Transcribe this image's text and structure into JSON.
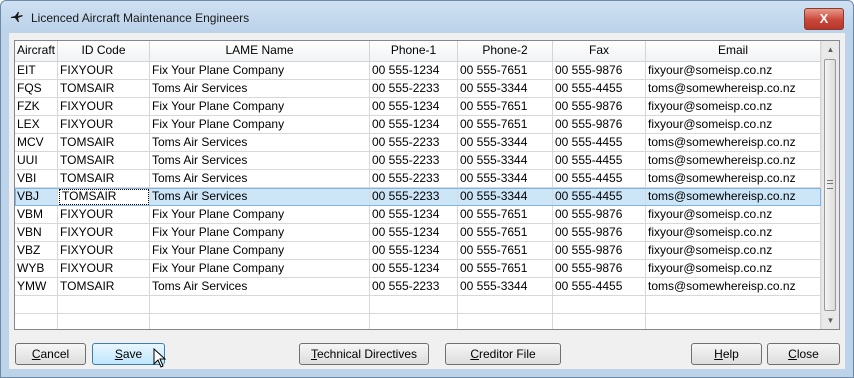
{
  "window": {
    "title": "Licenced Aircraft Maintenance Engineers",
    "close_symbol": "X"
  },
  "grid": {
    "columns": [
      "Aircraft",
      "ID Code",
      "LAME Name",
      "Phone-1",
      "Phone-2",
      "Fax",
      "Email"
    ],
    "selected_row": 7,
    "rows": [
      [
        "EIT",
        "FIXYOUR",
        "Fix Your Plane Company",
        "00 555-1234",
        "00 555-7651",
        "00 555-9876",
        "fixyour@someisp.co.nz"
      ],
      [
        "FQS",
        "TOMSAIR",
        "Toms Air Services",
        "00 555-2233",
        "00 555-3344",
        "00 555-4455",
        "toms@somewhereisp.co.nz"
      ],
      [
        "FZK",
        "FIXYOUR",
        "Fix Your Plane Company",
        "00 555-1234",
        "00 555-7651",
        "00 555-9876",
        "fixyour@someisp.co.nz"
      ],
      [
        "LEX",
        "FIXYOUR",
        "Fix Your Plane Company",
        "00 555-1234",
        "00 555-7651",
        "00 555-9876",
        "fixyour@someisp.co.nz"
      ],
      [
        "MCV",
        "TOMSAIR",
        "Toms Air Services",
        "00 555-2233",
        "00 555-3344",
        "00 555-4455",
        "toms@somewhereisp.co.nz"
      ],
      [
        "UUI",
        "TOMSAIR",
        "Toms Air Services",
        "00 555-2233",
        "00 555-3344",
        "00 555-4455",
        "toms@somewhereisp.co.nz"
      ],
      [
        "VBI",
        "TOMSAIR",
        "Toms Air Services",
        "00 555-2233",
        "00 555-3344",
        "00 555-4455",
        "toms@somewhereisp.co.nz"
      ],
      [
        "VBJ",
        "TOMSAIR",
        "Toms Air Services",
        "00 555-2233",
        "00 555-3344",
        "00 555-4455",
        "toms@somewhereisp.co.nz"
      ],
      [
        "VBM",
        "FIXYOUR",
        "Fix Your Plane Company",
        "00 555-1234",
        "00 555-7651",
        "00 555-9876",
        "fixyour@someisp.co.nz"
      ],
      [
        "VBN",
        "FIXYOUR",
        "Fix Your Plane Company",
        "00 555-1234",
        "00 555-7651",
        "00 555-9876",
        "fixyour@someisp.co.nz"
      ],
      [
        "VBZ",
        "FIXYOUR",
        "Fix Your Plane Company",
        "00 555-1234",
        "00 555-7651",
        "00 555-9876",
        "fixyour@someisp.co.nz"
      ],
      [
        "WYB",
        "FIXYOUR",
        "Fix Your Plane Company",
        "00 555-1234",
        "00 555-7651",
        "00 555-9876",
        "fixyour@someisp.co.nz"
      ],
      [
        "YMW",
        "TOMSAIR",
        "Toms Air Services",
        "00 555-2233",
        "00 555-3344",
        "00 555-4455",
        "toms@somewhereisp.co.nz"
      ],
      [
        "",
        "",
        "",
        "",
        "",
        "",
        ""
      ],
      [
        "",
        "",
        "",
        "",
        "",
        "",
        ""
      ]
    ]
  },
  "buttons": {
    "cancel": "Cancel",
    "save": "Save",
    "technical_directives": "Technical Directives",
    "creditor_file": "Creditor File",
    "help": "Help",
    "close": "Close"
  },
  "icons": {
    "app": "plane-icon",
    "scroll_up": "up-arrow-icon",
    "scroll_down": "down-arrow-icon"
  }
}
